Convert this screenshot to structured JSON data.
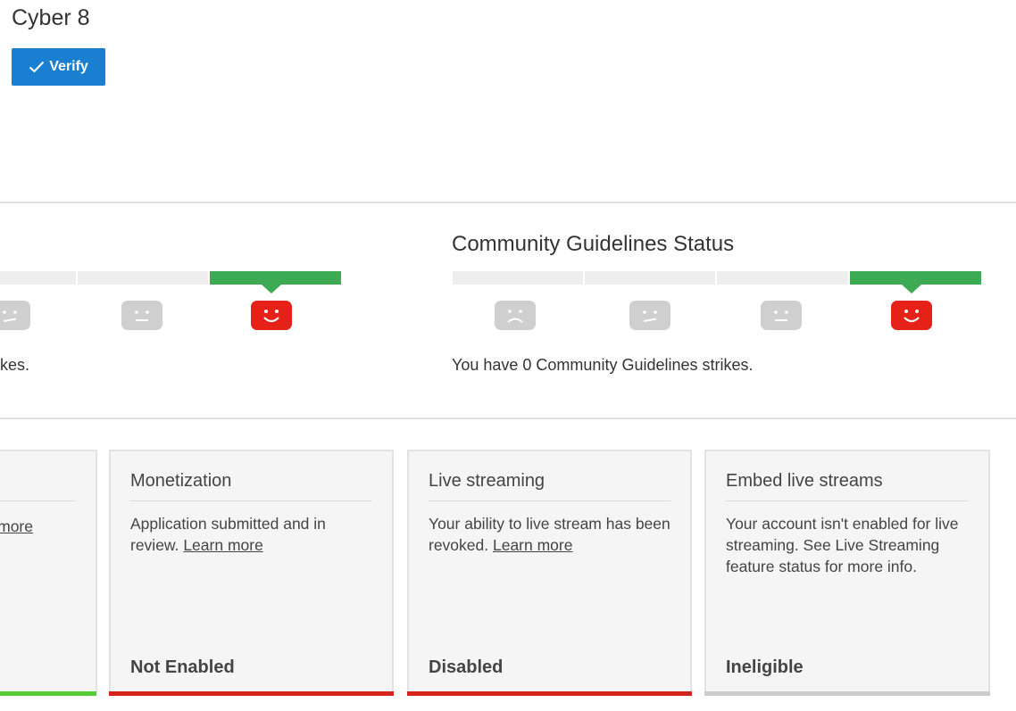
{
  "header": {
    "channel_name": "Cyber 8",
    "verify_label": "Verify"
  },
  "copyright": {
    "strike_text_partial": "kes."
  },
  "community": {
    "title": "Community Guidelines Status",
    "strike_text": "You have 0 Community Guidelines strikes."
  },
  "cards": [
    {
      "link_partial": "more",
      "bar_color": "#55cc33"
    },
    {
      "title": "Monetization",
      "desc": "Application submitted and in review. ",
      "link": "Learn more",
      "status": "Not Enabled",
      "bar_color": "#d6241c"
    },
    {
      "title": "Live streaming",
      "desc": "Your ability to live stream has been revoked. ",
      "link": "Learn more",
      "status": "Disabled",
      "bar_color": "#d6241c"
    },
    {
      "title": "Embed live streams",
      "desc": "Your account isn't enabled for live streaming. See Live Streaming feature status for more info.",
      "status": "Ineligible",
      "bar_color": "#cccccc"
    }
  ],
  "colors": {
    "accent": "#1a7fd0",
    "good": "#3dab53",
    "bad": "#e62117",
    "neutral_face": "#cfcfcf"
  },
  "icons": [
    "checkmark-icon",
    "sad-face-icon",
    "meh-face-icon",
    "neutral-face-icon",
    "happy-face-icon"
  ]
}
